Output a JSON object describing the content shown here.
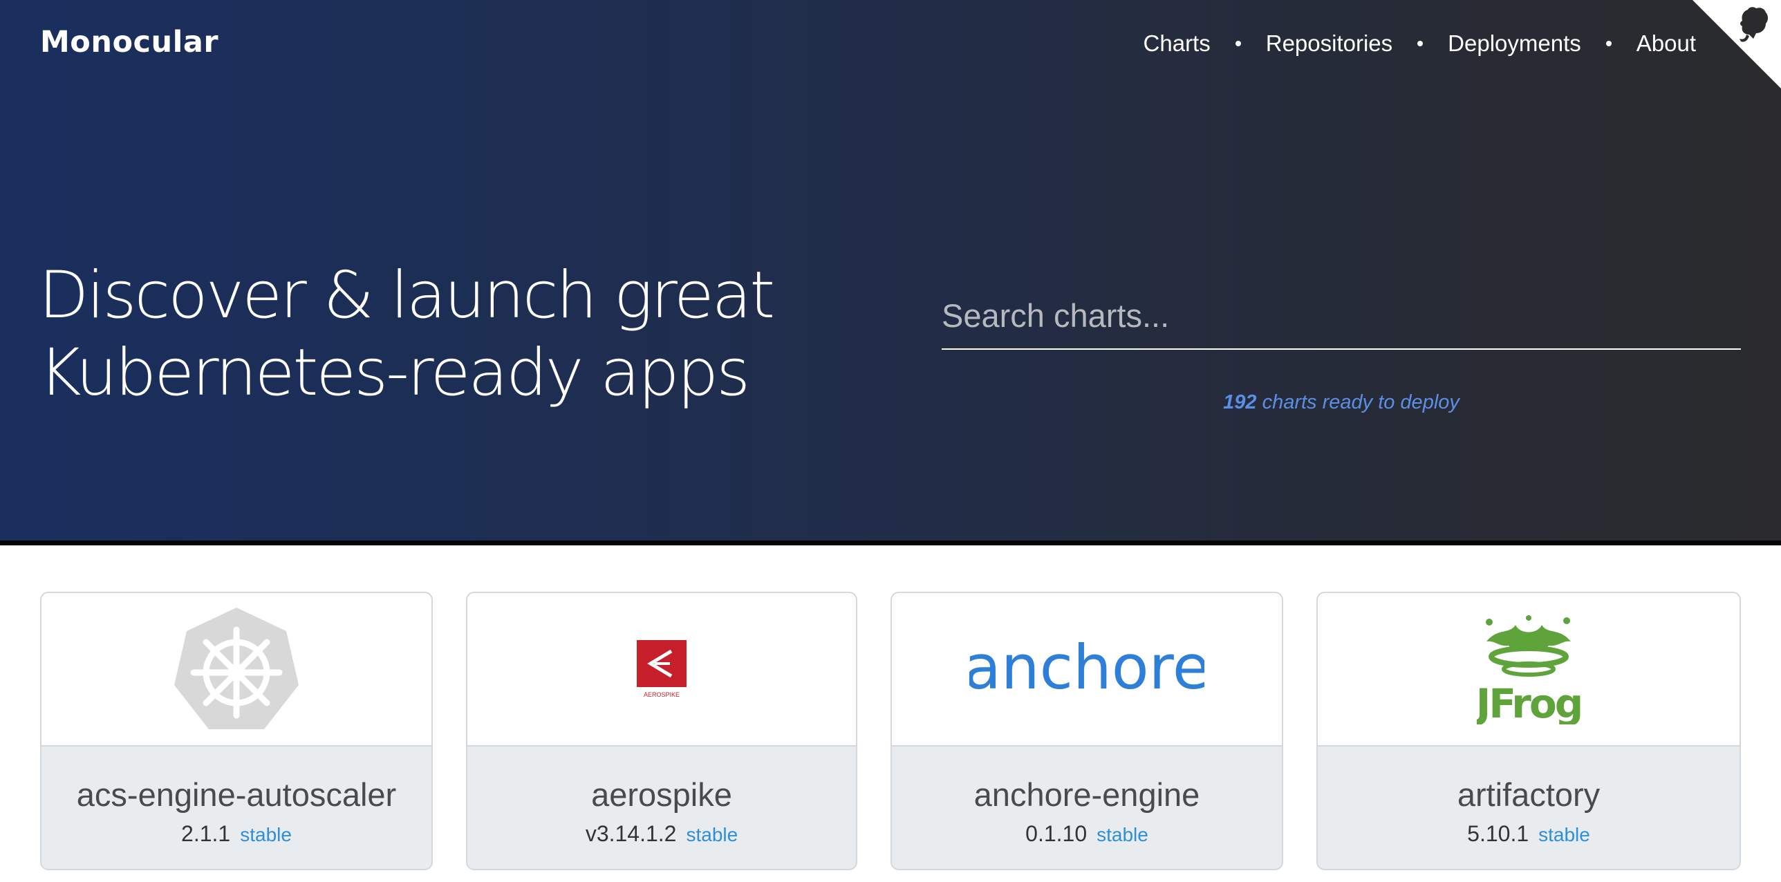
{
  "brand": "Monocular",
  "nav": {
    "charts": "Charts",
    "repositories": "Repositories",
    "deployments": "Deployments",
    "about": "About"
  },
  "hero": {
    "headline_line1": "Discover & launch great",
    "headline_line2": "Kubernetes-ready apps"
  },
  "search": {
    "placeholder": "Search charts...",
    "value": ""
  },
  "count": {
    "number": "192",
    "text": "charts ready to deploy"
  },
  "cards": [
    {
      "name": "acs-engine-autoscaler",
      "version": "2.1.1",
      "repo": "stable",
      "logo_icon": "kubernetes-helm-icon"
    },
    {
      "name": "aerospike",
      "version": "v3.14.1.2",
      "repo": "stable",
      "logo_icon": "aerospike-logo",
      "logo_text": "AEROSPIKE"
    },
    {
      "name": "anchore-engine",
      "version": "0.1.10",
      "repo": "stable",
      "logo_icon": "anchore-logo",
      "logo_text": "anchore"
    },
    {
      "name": "artifactory",
      "version": "5.10.1",
      "repo": "stable",
      "logo_icon": "jfrog-logo",
      "logo_text": "JFrog"
    }
  ],
  "colors": {
    "hero_left": "#1a2f5e",
    "hero_right": "#2b2b2d",
    "count_text": "#5b8fe6",
    "repo_link": "#2f8fd6",
    "aerospike_red": "#c8202a",
    "anchore_blue": "#2e7fd8",
    "jfrog_green": "#5fa33b"
  }
}
